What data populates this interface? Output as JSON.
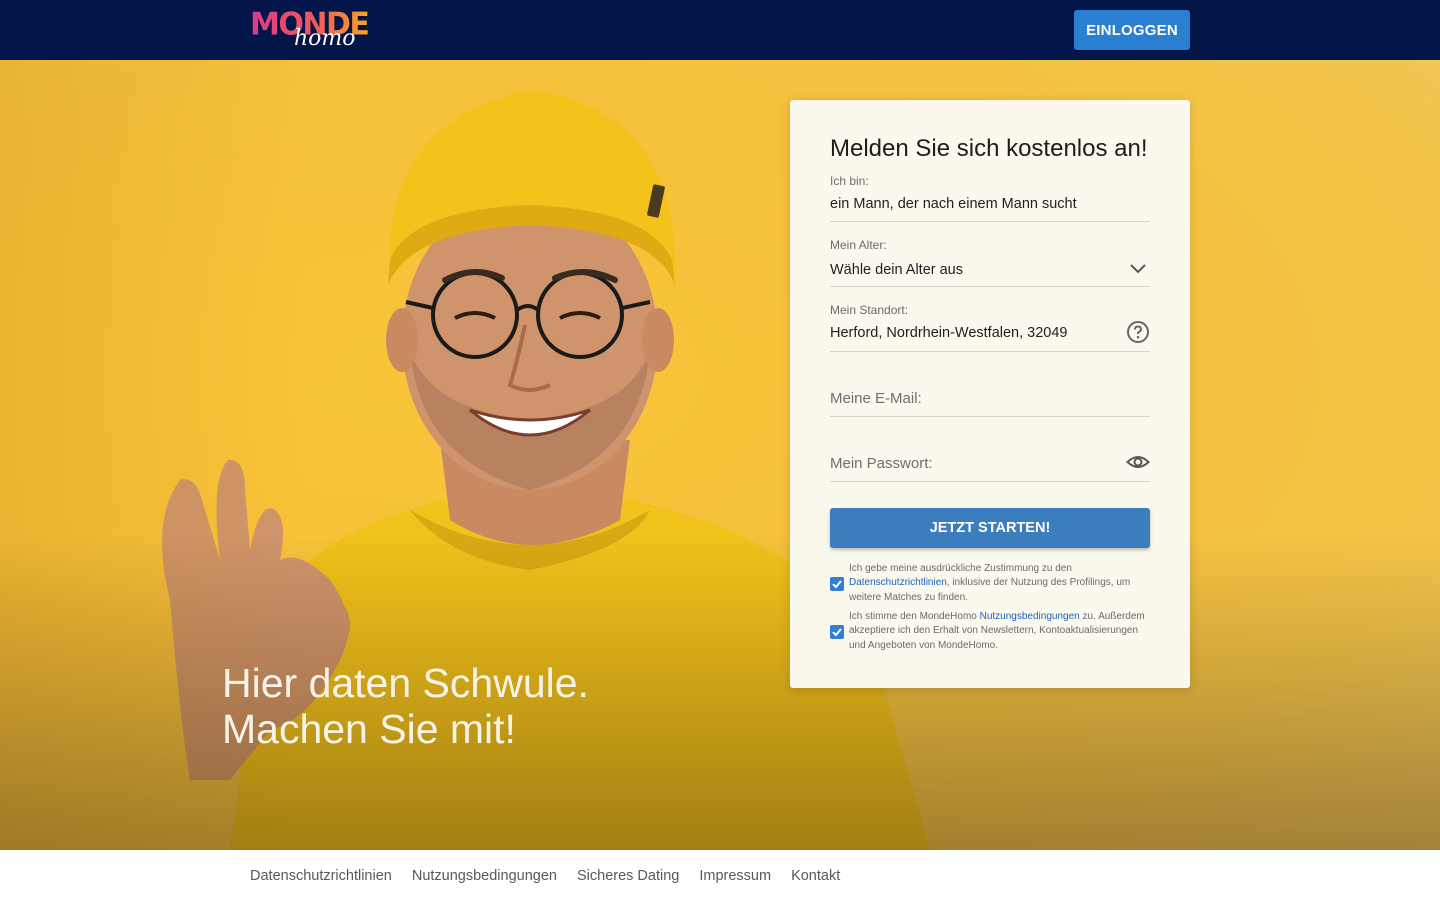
{
  "header": {
    "logo_word": "MONDE",
    "logo_script": "homo",
    "login_label": "EINLOGGEN"
  },
  "hero": {
    "headline": "Hier daten Schwule. Machen Sie mit!"
  },
  "form": {
    "title": "Melden Sie sich kostenlos an!",
    "gender": {
      "label": "Ich bin:",
      "value": "ein Mann, der nach einem Mann sucht"
    },
    "age": {
      "label": "Mein Alter:",
      "value": "Wähle dein Alter aus"
    },
    "location": {
      "label": "Mein Standort:",
      "value": "Herford, Nordrhein-Westfalen, 32049"
    },
    "email": {
      "placeholder": "Meine E-Mail:"
    },
    "password": {
      "placeholder": "Mein Passwort:"
    },
    "submit_label": "JETZT STARTEN!",
    "consent1": {
      "checked": true,
      "text_before": "Ich gebe meine ausdrückliche Zustimmung zu den ",
      "link": "Datenschutzrichtlinien",
      "text_after": ", inklusive der Nutzung des Profilings, um weitere Matches zu finden."
    },
    "consent2": {
      "checked": true,
      "text_before": "Ich stimme den MondeHomo ",
      "link": "Nutzungsbedingungen",
      "text_after": " zu. Außerdem akzeptiere ich den Erhalt von Newslettern, Kontoaktualisierungen und Angeboten von MondeHomo."
    }
  },
  "footer": {
    "links": [
      "Datenschutzrichtlinien",
      "Nutzungsbedingungen",
      "Sicheres Dating",
      "Impressum",
      "Kontakt"
    ]
  },
  "colors": {
    "header_bg": "#041549",
    "login_button": "#2a7fd1",
    "submit_button": "#3c7ebd",
    "hero_yellow": "#f5c13a",
    "checkbox": "#2f7fd3",
    "link": "#1f63b8"
  },
  "icons": {
    "age_dropdown": "chevron-down-icon",
    "location_help": "question-circle-icon",
    "password_toggle": "eye-icon",
    "checkbox_mark": "checkmark-icon"
  }
}
